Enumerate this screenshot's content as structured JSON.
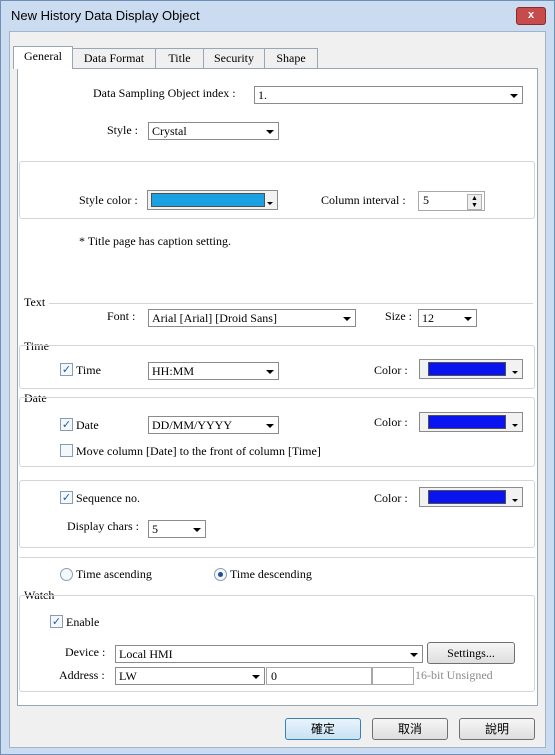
{
  "window": {
    "title": "New History Data Display Object",
    "close_label": "x"
  },
  "tabs": [
    "General",
    "Data Format",
    "Title",
    "Security",
    "Shape"
  ],
  "general": {
    "sampling_label": "Data Sampling Object index :",
    "sampling_value": "1.",
    "style_label": "Style :",
    "style_value": "Crystal",
    "style_color_label": "Style color :",
    "style_color": "#1ba1e2",
    "column_interval_label": "Column interval :",
    "column_interval_value": "5",
    "note": "* Title page has caption setting."
  },
  "text": {
    "group": "Text",
    "font_label": "Font :",
    "font_value": "Arial [Arial] [Droid Sans]",
    "size_label": "Size :",
    "size_value": "12"
  },
  "time": {
    "group": "Time",
    "checkbox_label": "Time",
    "format": "HH:MM",
    "color_label": "Color :",
    "color": "#0a14f0"
  },
  "date": {
    "group": "Date",
    "checkbox_label": "Date",
    "format": "DD/MM/YYYY",
    "color_label": "Color :",
    "color": "#0a14f0",
    "move_label": "Move column [Date] to the front of column [Time]"
  },
  "sequence": {
    "checkbox_label": "Sequence no.",
    "color_label": "Color :",
    "color": "#0a14f0",
    "display_chars_label": "Display chars :",
    "display_chars_value": "5"
  },
  "order": {
    "ascending_label": "Time ascending",
    "descending_label": "Time descending",
    "selected": "descending"
  },
  "watch": {
    "group": "Watch",
    "enable_label": "Enable",
    "device_label": "Device :",
    "device_value": "Local HMI",
    "settings_label": "Settings...",
    "address_label": "Address :",
    "address_type": "LW",
    "address_value": "0",
    "data_type": "16-bit Unsigned"
  },
  "buttons": {
    "ok": "確定",
    "cancel": "取消",
    "help": "說明"
  }
}
